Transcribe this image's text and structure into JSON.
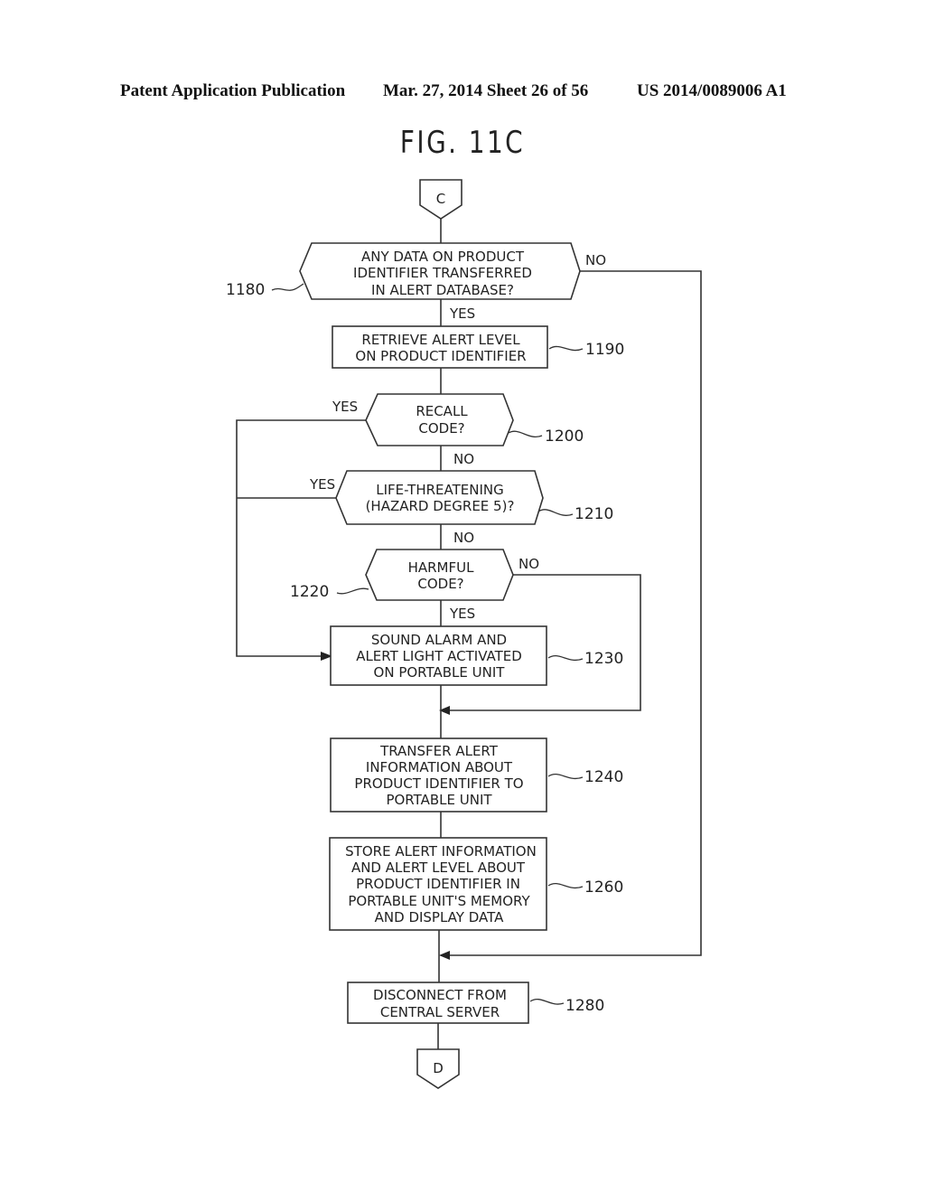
{
  "header": {
    "left": "Patent Application Publication",
    "middle": "Mar. 27, 2014  Sheet 26 of 56",
    "right": "US 2014/0089006 A1"
  },
  "figure": {
    "title": "FIG. 11C"
  },
  "connectors": {
    "start": "C",
    "end": "D"
  },
  "steps": {
    "s1180": {
      "ref": "1180",
      "type": "decision",
      "lines": [
        "ANY DATA ON PRODUCT",
        "IDENTIFIER TRANSFERRED",
        "IN ALERT DATABASE?"
      ],
      "yes_label": "YES",
      "no_label": "NO"
    },
    "s1190": {
      "ref": "1190",
      "type": "process",
      "lines": [
        "RETRIEVE ALERT LEVEL",
        "ON PRODUCT IDENTIFIER"
      ]
    },
    "s1200": {
      "ref": "1200",
      "type": "decision",
      "lines": [
        "RECALL",
        "CODE?"
      ],
      "yes_label": "YES",
      "no_label": "NO"
    },
    "s1210": {
      "ref": "1210",
      "type": "decision",
      "lines": [
        "LIFE-THREATENING",
        "(HAZARD DEGREE 5)?"
      ],
      "yes_label": "YES",
      "no_label": "NO"
    },
    "s1220": {
      "ref": "1220",
      "type": "decision",
      "lines": [
        "HARMFUL",
        "CODE?"
      ],
      "yes_label": "YES",
      "no_label": "NO"
    },
    "s1230": {
      "ref": "1230",
      "type": "process",
      "lines": [
        "SOUND ALARM AND",
        "ALERT LIGHT ACTIVATED",
        "ON PORTABLE UNIT"
      ]
    },
    "s1240": {
      "ref": "1240",
      "type": "process",
      "lines": [
        "TRANSFER ALERT",
        "INFORMATION ABOUT",
        "PRODUCT IDENTIFIER TO",
        "PORTABLE UNIT"
      ]
    },
    "s1260": {
      "ref": "1260",
      "type": "process",
      "lines": [
        "STORE ALERT INFORMATION",
        "AND ALERT LEVEL ABOUT",
        "PRODUCT IDENTIFIER IN",
        "PORTABLE UNIT'S MEMORY",
        "AND DISPLAY DATA"
      ]
    },
    "s1280": {
      "ref": "1280",
      "type": "process",
      "lines": [
        "DISCONNECT FROM",
        "CENTRAL SERVER"
      ]
    }
  }
}
